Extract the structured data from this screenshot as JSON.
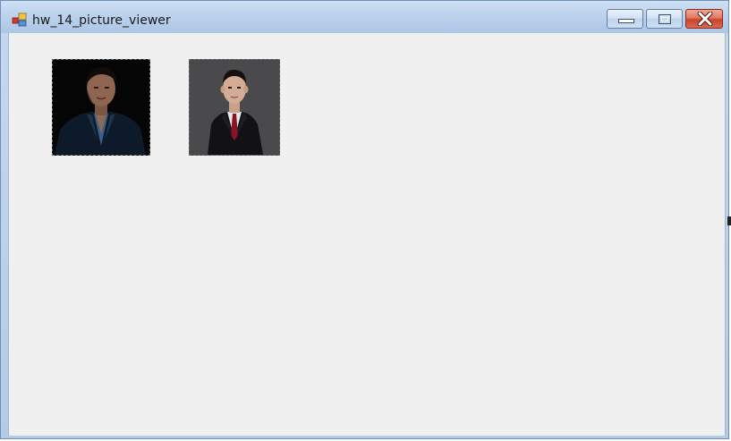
{
  "window": {
    "title": "hw_14_picture_viewer",
    "app_icon": "forms-app-icon",
    "controls": {
      "minimize_icon": "minimize-icon",
      "maximize_icon": "maximize-icon",
      "close_icon": "close-icon"
    }
  },
  "pictures": [
    {
      "name": "portrait-man-dark-background",
      "background": "#050505"
    },
    {
      "name": "portrait-man-in-suit",
      "background": "#4a4a4c"
    }
  ],
  "colors": {
    "client_background": "#f0f0f0",
    "close_button": "#c9432a",
    "titlebar": "#bcd2ec"
  }
}
